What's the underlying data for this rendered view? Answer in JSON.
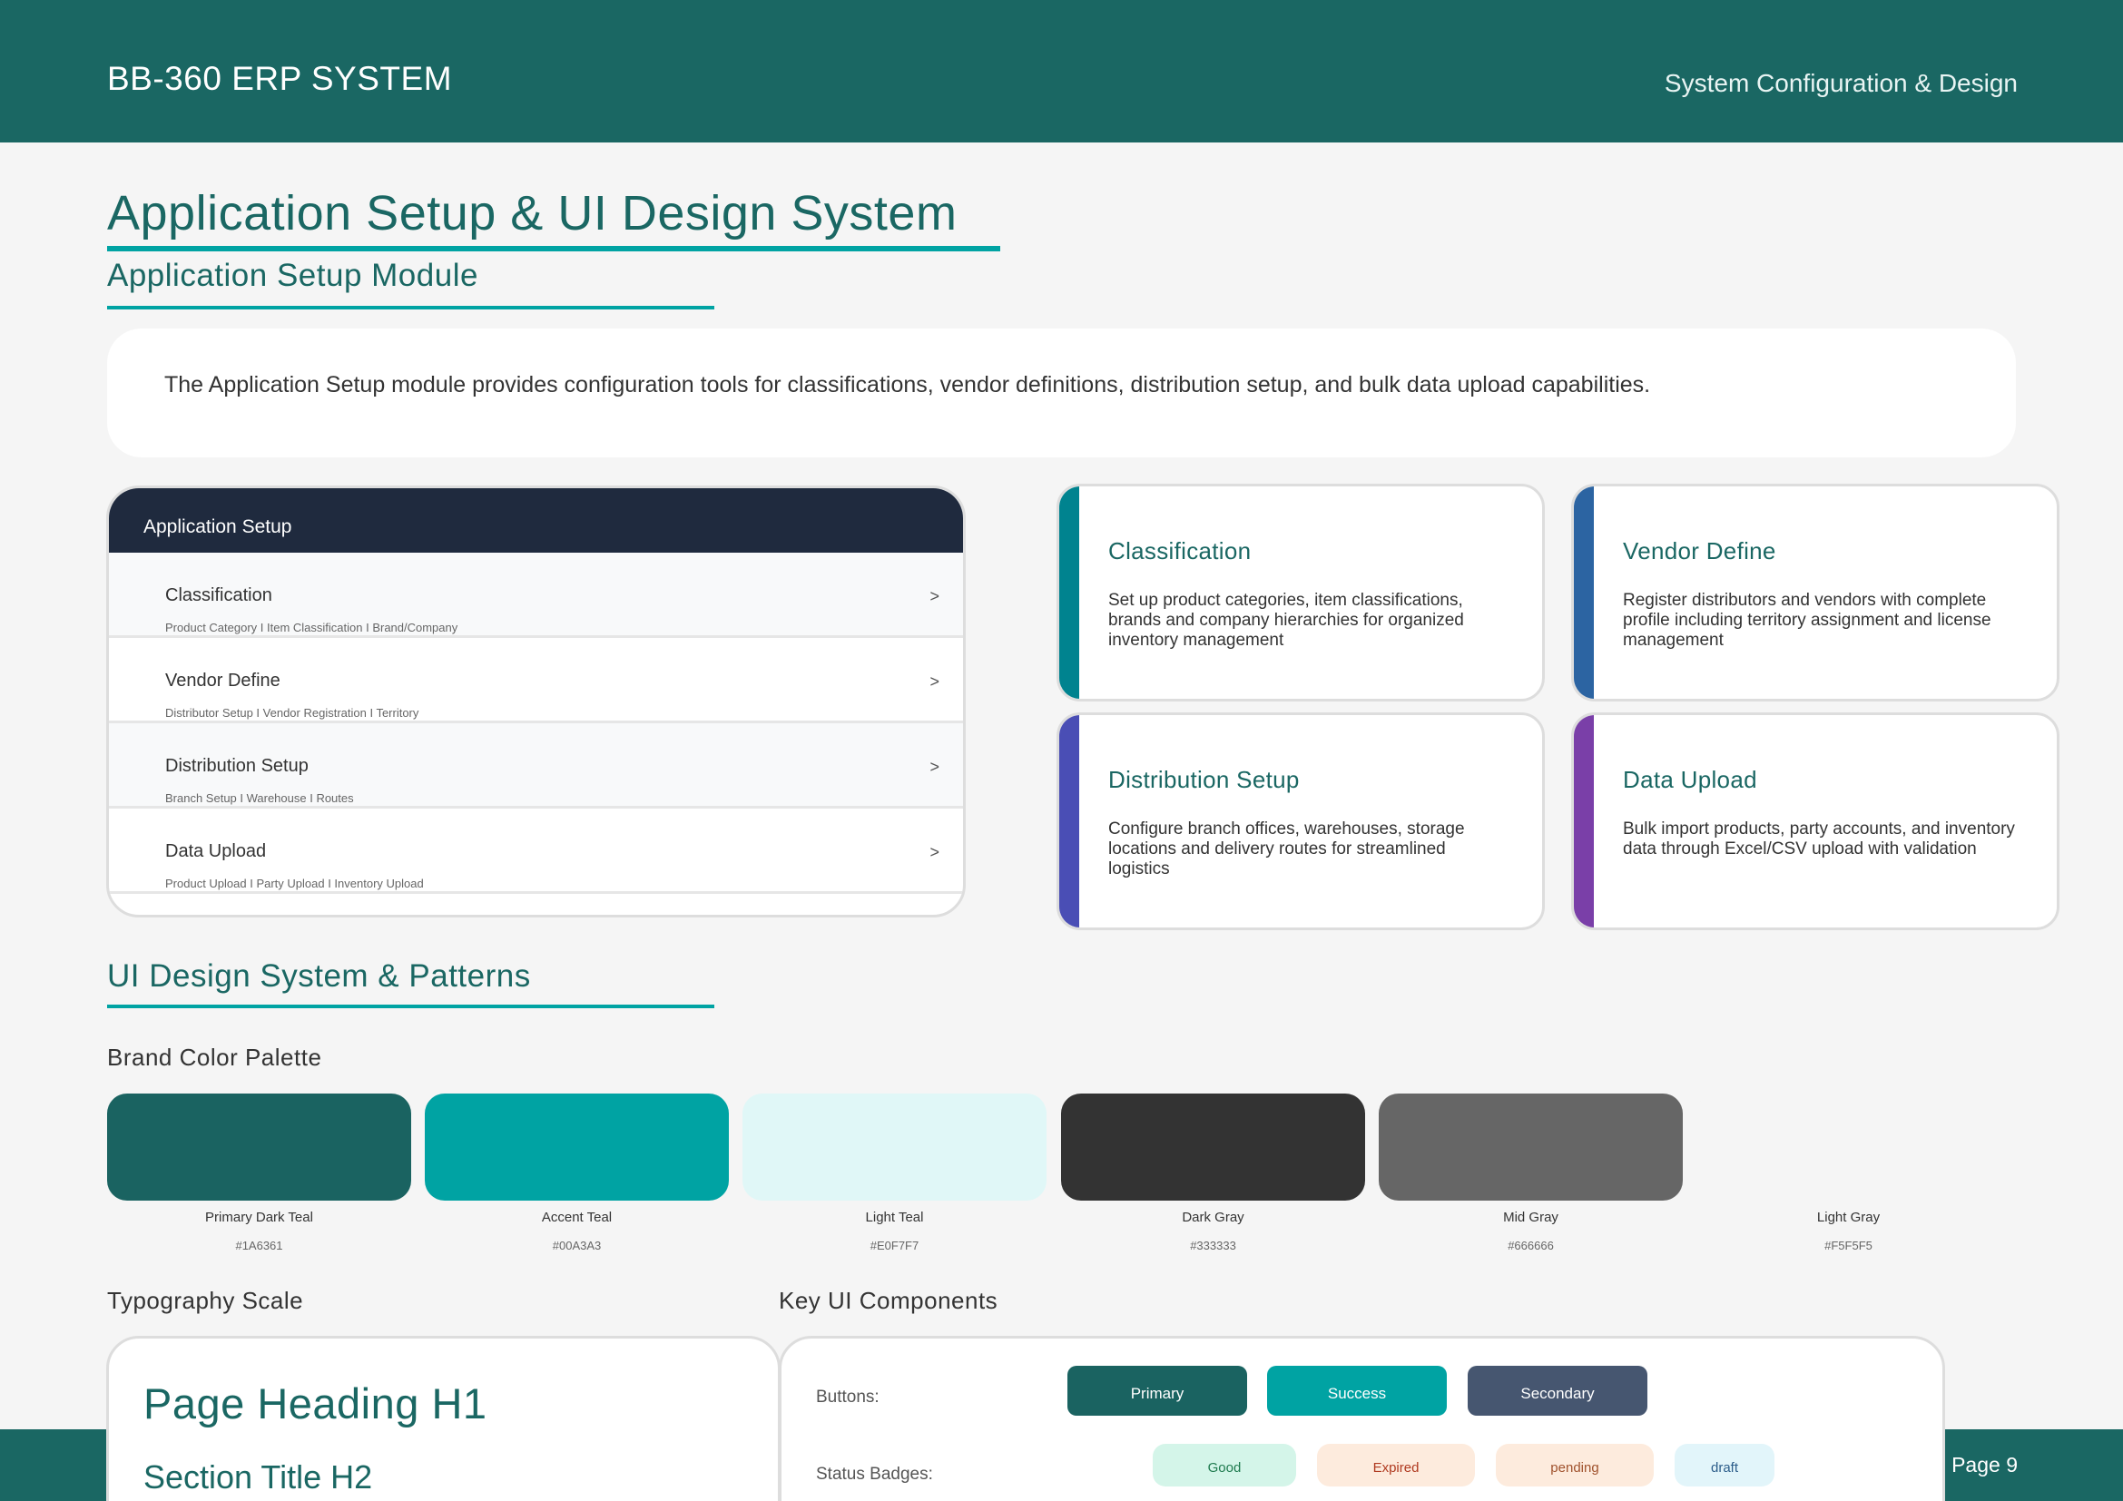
{
  "header": {
    "brand": "BB-360 ERP SYSTEM",
    "subtitle": "System Configuration & Design"
  },
  "title": "Application Setup & UI Design System",
  "section_setup": {
    "title": "Application Setup Module",
    "intro": "The Application Setup module provides configuration tools for classifications, vendor definitions, distribution setup, and bulk data upload capabilities."
  },
  "menu": {
    "header": "Application Setup",
    "arrow": ">",
    "items": [
      {
        "title": "Classification",
        "sub": "Product Category I Item Classification I Brand/Company"
      },
      {
        "title": "Vendor Define",
        "sub": "Distributor Setup I Vendor Registration I Territory"
      },
      {
        "title": "Distribution Setup",
        "sub": "Branch Setup I Warehouse I Routes"
      },
      {
        "title": "Data Upload",
        "sub": "Product Upload I Party Upload I Inventory Upload"
      }
    ]
  },
  "cards": [
    {
      "title": "Classification",
      "desc": "Set up product categories, item classifications, brands and company hierarchies for organized inventory management",
      "color": "#00838F"
    },
    {
      "title": "Vendor Define",
      "desc": "Register distributors and vendors with complete profile including territory assignment and license management",
      "color": "#2C64A2"
    },
    {
      "title": "Distribution Setup",
      "desc": "Configure branch offices, warehouses, storage locations and delivery routes for streamlined logistics",
      "color": "#4A4EB5"
    },
    {
      "title": "Data Upload",
      "desc": "Bulk import products, party accounts, and inventory data through Excel/CSV upload with validation",
      "color": "#7A3FA8"
    }
  ],
  "section_ui": {
    "title": "UI Design System & Patterns"
  },
  "palette": {
    "title": "Brand Color Palette",
    "colors": [
      {
        "name": "Primary Dark Teal",
        "hex": "#1A6361"
      },
      {
        "name": "Accent Teal",
        "hex": "#00A3A3"
      },
      {
        "name": "Light Teal",
        "hex": "#E0F7F7"
      },
      {
        "name": "Dark Gray",
        "hex": "#333333"
      },
      {
        "name": "Mid Gray",
        "hex": "#666666"
      },
      {
        "name": "Light Gray",
        "hex": "#F5F5F5"
      }
    ]
  },
  "typography": {
    "title": "Typography Scale",
    "h1": "Page Heading H1",
    "h2": "Section Title H2"
  },
  "components": {
    "title": "Key UI Components",
    "buttons_label": "Buttons:",
    "buttons": [
      {
        "label": "Primary",
        "color": "#1A6361"
      },
      {
        "label": "Success",
        "color": "#00A3A3"
      },
      {
        "label": "Secondary",
        "color": "#465670"
      }
    ],
    "badges_label": "Status Badges:",
    "badges": [
      {
        "label": "Good",
        "bg": "#D4F5E9",
        "fg": "#1E7A4E"
      },
      {
        "label": "Expired",
        "bg": "#FDEBDD",
        "fg": "#B03A20"
      },
      {
        "label": "pending",
        "bg": "#FDEBDD",
        "fg": "#A0522D"
      },
      {
        "label": "draft",
        "bg": "#E2F5FA",
        "fg": "#2C5D8A"
      }
    ]
  },
  "footer": {
    "page": "Page 9"
  }
}
